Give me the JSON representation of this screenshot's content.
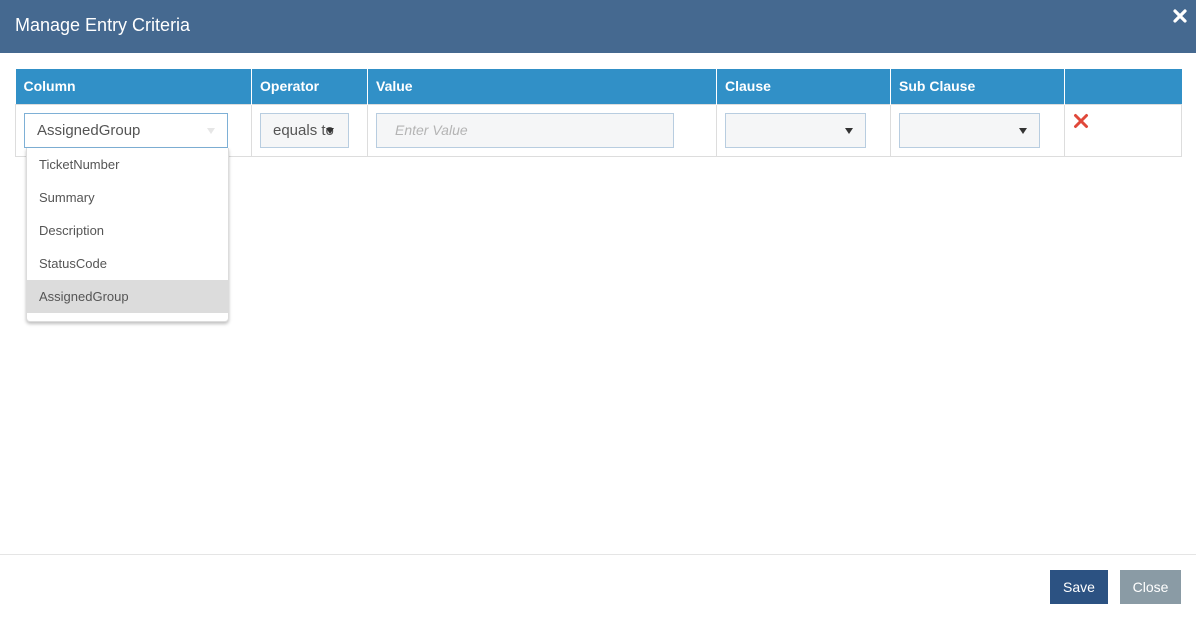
{
  "dialog": {
    "title": "Manage Entry Criteria"
  },
  "table": {
    "headers": [
      "Column",
      "Operator",
      "Value",
      "Clause",
      "Sub Clause",
      ""
    ],
    "row": {
      "column_value": "AssignedGroup",
      "operator_value": "equals to",
      "value_placeholder": "Enter Value",
      "clause_value": "",
      "subclause_value": ""
    }
  },
  "column_dropdown": {
    "options": [
      "TicketNumber",
      "Summary",
      "Description",
      "StatusCode",
      "AssignedGroup"
    ],
    "selected": "AssignedGroup"
  },
  "footer": {
    "save_label": "Save",
    "close_label": "Close"
  },
  "colors": {
    "header_bg": "#456990",
    "table_header_bg": "#3190c7",
    "delete_icon": "#e0483a",
    "save_button": "#2c5282",
    "close_button": "#8a9ba5"
  }
}
